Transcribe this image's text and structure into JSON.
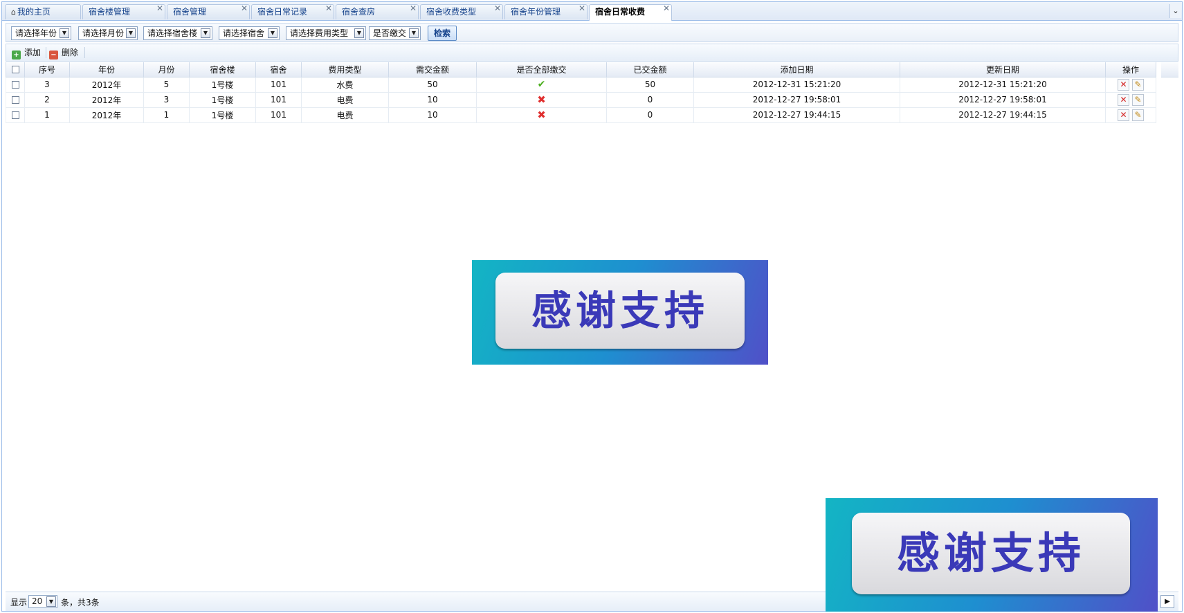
{
  "tabs": [
    {
      "label": "我的主页",
      "closable": false
    },
    {
      "label": "宿舍楼管理",
      "closable": true
    },
    {
      "label": "宿舍管理",
      "closable": true
    },
    {
      "label": "宿舍日常记录",
      "closable": true
    },
    {
      "label": "宿舍查房",
      "closable": true
    },
    {
      "label": "宿舍收费类型",
      "closable": true
    },
    {
      "label": "宿舍年份管理",
      "closable": true
    },
    {
      "label": "宿舍日常收费",
      "closable": true,
      "active": true
    }
  ],
  "filters": {
    "year": "请选择年份",
    "month": "请选择月份",
    "building": "请选择宿舍楼",
    "dorm": "请选择宿舍",
    "fee_type": "请选择费用类型",
    "paid": "是否缴交",
    "search_label": "检索"
  },
  "toolbar": {
    "add_label": "添加",
    "delete_label": "删除"
  },
  "grid": {
    "columns": [
      "序号",
      "年份",
      "月份",
      "宿舍楼",
      "宿舍",
      "费用类型",
      "需交金额",
      "是否全部缴交",
      "已交金额",
      "添加日期",
      "更新日期",
      "操作"
    ],
    "rows": [
      {
        "seq": "3",
        "year": "2012年",
        "month": "5",
        "building": "1号楼",
        "dorm": "101",
        "fee_type": "水费",
        "due": "50",
        "all_paid": true,
        "paid": "50",
        "added": "2012-12-31 15:21:20",
        "updated": "2012-12-31 15:21:20"
      },
      {
        "seq": "2",
        "year": "2012年",
        "month": "3",
        "building": "1号楼",
        "dorm": "101",
        "fee_type": "电费",
        "due": "10",
        "all_paid": false,
        "paid": "0",
        "added": "2012-12-27 19:58:01",
        "updated": "2012-12-27 19:58:01"
      },
      {
        "seq": "1",
        "year": "2012年",
        "month": "1",
        "building": "1号楼",
        "dorm": "101",
        "fee_type": "电费",
        "due": "10",
        "all_paid": false,
        "paid": "0",
        "added": "2012-12-27 19:44:15",
        "updated": "2012-12-27 19:44:15"
      }
    ]
  },
  "banners": {
    "text": "感谢支持"
  },
  "paging": {
    "show_label": "显示",
    "page_size": "20",
    "summary": "条，共3条"
  },
  "colors": {
    "accent": "#15428b",
    "border": "#99bbe8",
    "check": "#4caf1f",
    "cross": "#e03030"
  }
}
